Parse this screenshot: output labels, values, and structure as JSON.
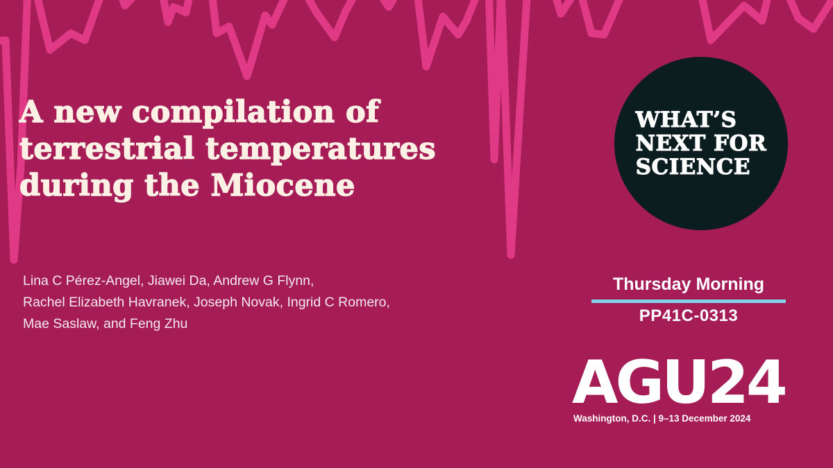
{
  "colors": {
    "background": "#a51c56",
    "wave": "#e03a86",
    "title_text": "#fdf1e6",
    "badge_background": "#0c1d20",
    "session_underline": "#7fd4e6"
  },
  "title_lines": [
    "A new compilation of",
    "terrestrial temperatures",
    "during the Miocene"
  ],
  "author_lines": [
    "Lina C Pérez-Angel, Jiawei Da, Andrew G Flynn,",
    "Rachel Elizabeth Havranek, Joseph Novak, Ingrid C Romero,",
    "Mae Saslaw, and Feng Zhu"
  ],
  "badge": {
    "lines": [
      "WHAT’S",
      "NEXT FOR",
      "SCIENCE"
    ]
  },
  "session": {
    "day": "Thursday Morning",
    "code": "PP41C-0313"
  },
  "event": {
    "logo": "AGU24",
    "tagline": "Washington, D.C. | 9–13 December 2024"
  }
}
